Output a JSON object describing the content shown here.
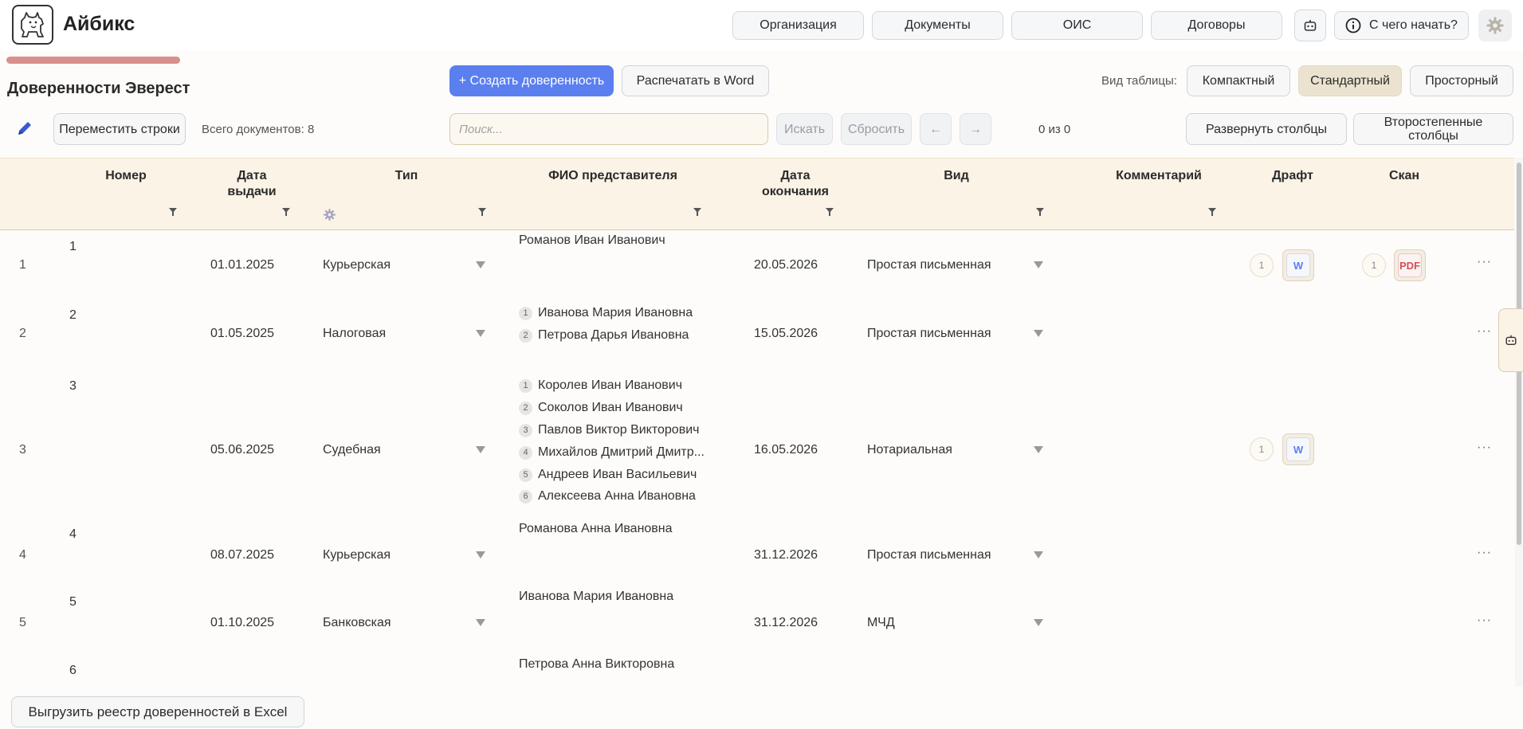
{
  "app": {
    "name": "Айбикс"
  },
  "nav": {
    "organization": "Организация",
    "documents": "Документы",
    "ois": "ОИС",
    "contracts": "Договоры",
    "help": "С чего начать?"
  },
  "page": {
    "title": "Доверенности Эверест"
  },
  "toolbar": {
    "create": "+ Создать доверенность",
    "print_word": "Распечатать в Word",
    "view_label": "Вид таблицы:",
    "view_compact": "Компактный",
    "view_standard": "Стандартный",
    "view_spacious": "Просторный",
    "move_rows": "Переместить строки",
    "total_docs": "Всего документов: 8",
    "search_placeholder": "Поиск...",
    "search_btn": "Искать",
    "reset_btn": "Сбросить",
    "prev": "←",
    "next": "→",
    "page_counter": "0 из 0",
    "expand_columns": "Развернуть столбцы",
    "secondary_columns": "Второстепенные столбцы"
  },
  "columns": {
    "number": "Номер",
    "issue_date": "Дата выдачи",
    "type": "Тип",
    "representative": "ФИО представителя",
    "end_date": "Дата окончания",
    "kind": "Вид",
    "comment": "Комментарий",
    "draft": "Драфт",
    "scan": "Скан"
  },
  "rows": [
    {
      "index": "1",
      "number": "1",
      "issue_date": "01.01.2025",
      "type": "Курьерская",
      "reps": [
        "Романов Иван Иванович"
      ],
      "end_date": "20.05.2026",
      "kind": "Простая письменная",
      "draft_count": "1",
      "draft_label": "W",
      "scan_count": "1",
      "scan_label": "PDF"
    },
    {
      "index": "2",
      "number": "2",
      "issue_date": "01.05.2025",
      "type": "Налоговая",
      "reps": [
        "Иванова Мария Ивановна",
        "Петрова Дарья Ивановна"
      ],
      "end_date": "15.05.2026",
      "kind": "Простая письменная"
    },
    {
      "index": "3",
      "number": "3",
      "issue_date": "05.06.2025",
      "type": "Судебная",
      "reps": [
        "Королев Иван Иванович",
        "Соколов Иван Иванович",
        "Павлов Виктор Викторович",
        "Михайлов Дмитрий Дмитр...",
        "Андреев Иван Васильевич",
        "Алексеева Анна Ивановна"
      ],
      "end_date": "16.05.2026",
      "kind": "Нотариальная",
      "draft_count": "1",
      "draft_label": "W"
    },
    {
      "index": "4",
      "number": "4",
      "issue_date": "08.07.2025",
      "type": "Курьерская",
      "reps": [
        "Романова Анна Ивановна"
      ],
      "end_date": "31.12.2026",
      "kind": "Простая письменная"
    },
    {
      "index": "5",
      "number": "5",
      "issue_date": "01.10.2025",
      "type": "Банковская",
      "reps": [
        "Иванова Мария Ивановна"
      ],
      "end_date": "31.12.2026",
      "kind": "МЧД"
    },
    {
      "index": "",
      "number": "6",
      "issue_date": "",
      "type": "",
      "reps": [
        "Петрова Анна Викторовна"
      ],
      "end_date": "",
      "kind": ""
    }
  ],
  "rep_numbers": [
    "1",
    "2",
    "3",
    "4",
    "5",
    "6"
  ],
  "row_menu": "···",
  "footer": {
    "export_excel": "Выгрузить реестр доверенностей в Excel"
  },
  "colors": {
    "primary": "#5b7fef",
    "progress": "#d7918c",
    "header_bg": "#faf3e6",
    "active_view": "#ebe3d0"
  }
}
